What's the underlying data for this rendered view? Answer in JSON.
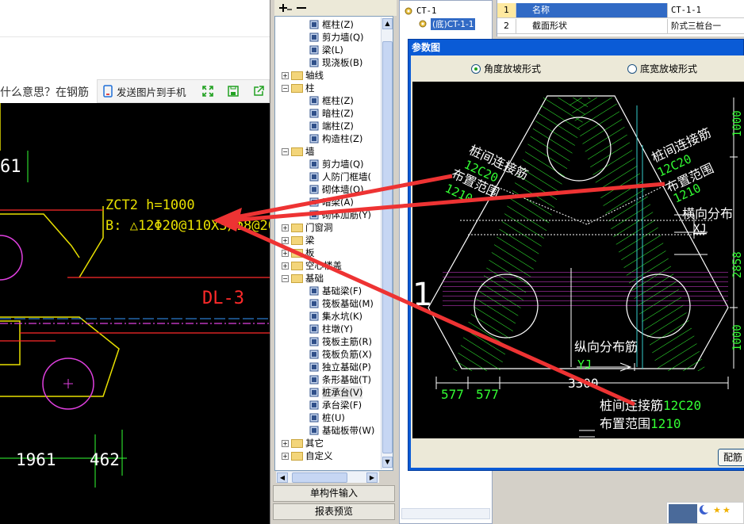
{
  "web": {
    "question_text": "什么意思？在钢筋",
    "send_label": "发送图片到手机"
  },
  "cad_left": {
    "dim_top": "61",
    "zct_label": "ZCT2 h=1000",
    "b_label": "B: △12Φ20@110X3/Φ8@200",
    "dl_label": "DL-3",
    "dim_1961": "1961",
    "dim_462": "462"
  },
  "tree": {
    "items": [
      {
        "label": "框柱(Z)",
        "kind": "leaf",
        "indent": 2
      },
      {
        "label": "剪力墙(Q)",
        "kind": "leaf",
        "indent": 2
      },
      {
        "label": "梁(L)",
        "kind": "leaf",
        "indent": 2
      },
      {
        "label": "现浇板(B)",
        "kind": "leaf",
        "indent": 2
      },
      {
        "label": "轴线",
        "kind": "folder-closed",
        "indent": 0
      },
      {
        "label": "柱",
        "kind": "folder-open",
        "indent": 0
      },
      {
        "label": "框柱(Z)",
        "kind": "leaf",
        "indent": 2
      },
      {
        "label": "暗柱(Z)",
        "kind": "leaf",
        "indent": 2
      },
      {
        "label": "端柱(Z)",
        "kind": "leaf",
        "indent": 2
      },
      {
        "label": "构造柱(Z)",
        "kind": "leaf",
        "indent": 2
      },
      {
        "label": "墙",
        "kind": "folder-open",
        "indent": 0
      },
      {
        "label": "剪力墙(Q)",
        "kind": "leaf",
        "indent": 2
      },
      {
        "label": "人防门框墙(",
        "kind": "leaf",
        "indent": 2
      },
      {
        "label": "砌体墙(Q)",
        "kind": "leaf",
        "indent": 2
      },
      {
        "label": "暗梁(A)",
        "kind": "leaf",
        "indent": 2
      },
      {
        "label": "砌体加筋(Y)",
        "kind": "leaf",
        "indent": 2
      },
      {
        "label": "门窗洞",
        "kind": "folder-closed",
        "indent": 0
      },
      {
        "label": "梁",
        "kind": "folder-closed",
        "indent": 0
      },
      {
        "label": "板",
        "kind": "folder-closed",
        "indent": 0
      },
      {
        "label": "空心楼盖",
        "kind": "folder-closed",
        "indent": 0
      },
      {
        "label": "基础",
        "kind": "folder-open",
        "indent": 0
      },
      {
        "label": "基础梁(F)",
        "kind": "leaf",
        "indent": 2
      },
      {
        "label": "筏板基础(M)",
        "kind": "leaf",
        "indent": 2
      },
      {
        "label": "集水坑(K)",
        "kind": "leaf",
        "indent": 2
      },
      {
        "label": "柱墩(Y)",
        "kind": "leaf",
        "indent": 2
      },
      {
        "label": "筏板主筋(R)",
        "kind": "leaf",
        "indent": 2
      },
      {
        "label": "筏板负筋(X)",
        "kind": "leaf",
        "indent": 2
      },
      {
        "label": "独立基础(P)",
        "kind": "leaf",
        "indent": 2
      },
      {
        "label": "条形基础(T)",
        "kind": "leaf",
        "indent": 2
      },
      {
        "label": "桩承台(V)",
        "kind": "leaf",
        "indent": 2
      },
      {
        "label": "承台梁(F)",
        "kind": "leaf",
        "indent": 2
      },
      {
        "label": "桩(U)",
        "kind": "leaf",
        "indent": 2
      },
      {
        "label": "基础板带(W)",
        "kind": "leaf",
        "indent": 2
      },
      {
        "label": "其它",
        "kind": "folder-closed",
        "indent": 0
      },
      {
        "label": "自定义",
        "kind": "folder-closed",
        "indent": 0
      }
    ],
    "btn_single": "单构件输入",
    "btn_report": "报表预览"
  },
  "mini_tree": {
    "item1": "CT-1",
    "item2": "(底)CT-1-1"
  },
  "props": {
    "rows": [
      {
        "num": "1",
        "name": "名称",
        "value": "CT-1-1"
      },
      {
        "num": "2",
        "name": "截面形状",
        "value": "阶式三桩台一"
      }
    ]
  },
  "dialog": {
    "title": "参数图",
    "radio_angle": "角度放坡形式",
    "radio_width": "底宽放坡形式",
    "cfg_btn": "配筋",
    "canvas": {
      "left_l1": "桩间连接筋",
      "left_l2": "12C20",
      "left_l3": "布置范围",
      "left_l4": "1210",
      "right_l1": "桩间连接筋",
      "right_l2": "12C20",
      "right_l3": "布置范围",
      "right_l4": "1210",
      "hx_label": "横向分布",
      "xj": "XJ",
      "dim_1000a": "1000",
      "dim_2858": "2858",
      "dim_1000b": "1000",
      "one": "1",
      "zx_label": "纵向分布筋",
      "yj": "YJ",
      "dim_577a": "577",
      "dim_577b": "577",
      "dim_3300": "3300",
      "bottom_l1": "桩间连接筋",
      "bottom_l1v": "12C20",
      "bottom_l2": "布置范围",
      "bottom_l2v": "1210"
    }
  },
  "colors": {
    "cad_yellow": "#e8e000",
    "cad_red": "#ff2a2a",
    "cad_magenta": "#e040e0",
    "cad_green": "#33ff33",
    "cad_white": "#ffffff",
    "arrow_red": "#ee3333",
    "title_blue": "#0a5bd6"
  }
}
